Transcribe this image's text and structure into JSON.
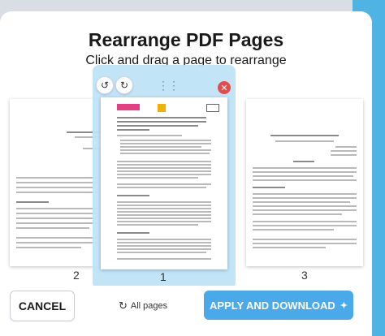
{
  "dialog": {
    "title": "Rearrange PDF Pages",
    "subtitle": "Click and drag a page to rearrange"
  },
  "pages": [
    {
      "number": "2"
    },
    {
      "number": "1"
    },
    {
      "number": "3"
    }
  ],
  "controls": {
    "rotate_left_icon": "↺",
    "rotate_right_icon": "↻",
    "drag_handle_icon": "⋮⋮",
    "remove_icon": "✕"
  },
  "footer": {
    "cancel_label": "CANCEL",
    "all_pages_label": "All pages",
    "all_pages_icon": "↻",
    "apply_label": "APPLY AND DOWNLOAD",
    "apply_icon": "✦"
  },
  "colors": {
    "accent": "#4aa9e8",
    "drag_highlight": "#bfe3f7",
    "close": "#e64b4b"
  }
}
